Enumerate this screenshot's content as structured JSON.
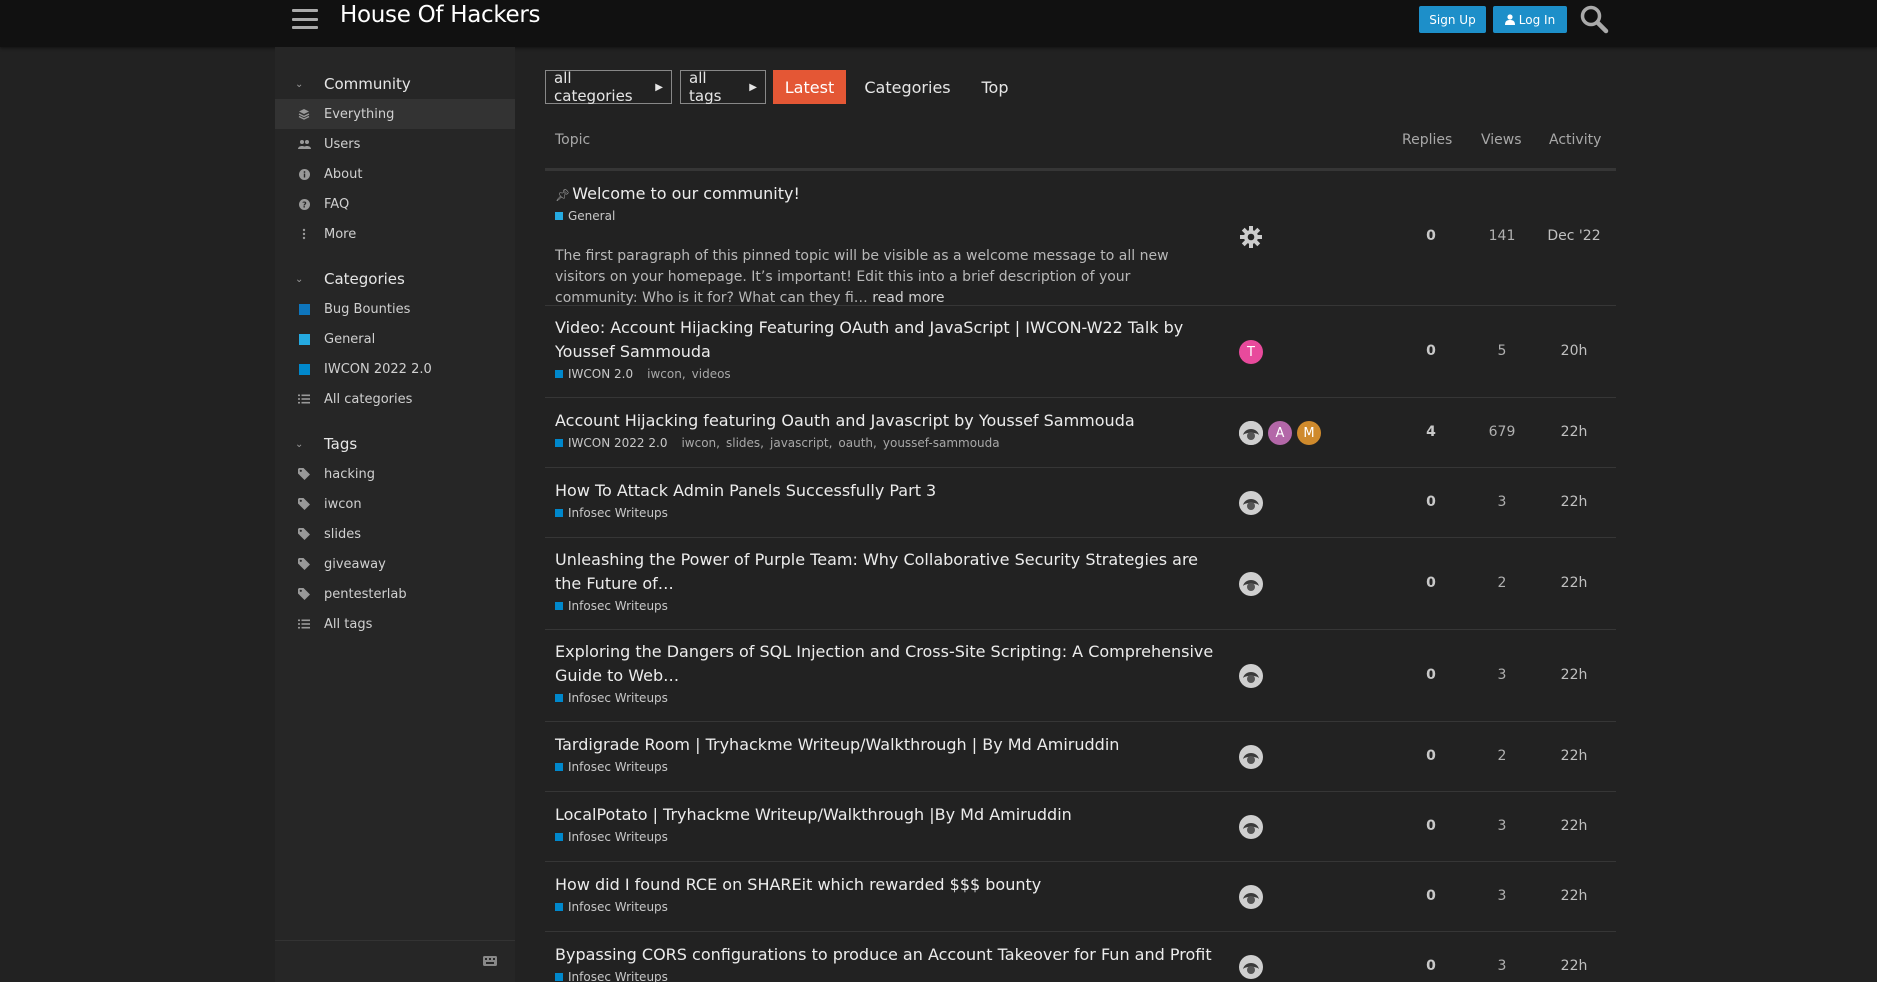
{
  "header": {
    "title": "House Of Hackers",
    "signup_label": "Sign Up",
    "login_label": "Log In"
  },
  "sidebar": {
    "community": {
      "label": "Community",
      "items": [
        {
          "label": "Everything",
          "icon": "layers-icon"
        },
        {
          "label": "Users",
          "icon": "users-icon"
        },
        {
          "label": "About",
          "icon": "info-icon"
        },
        {
          "label": "FAQ",
          "icon": "question-icon"
        },
        {
          "label": "More",
          "icon": "vertical-ellipsis-icon"
        }
      ]
    },
    "categories": {
      "label": "Categories",
      "items": [
        {
          "label": "Bug Bounties",
          "color": "#0e76bd"
        },
        {
          "label": "General",
          "color": "#25aae1"
        },
        {
          "label": "IWCON 2022 2.0",
          "color": "#0088cc"
        },
        {
          "label": "All categories",
          "icon": "list-icon"
        }
      ]
    },
    "tags": {
      "label": "Tags",
      "items": [
        {
          "label": "hacking"
        },
        {
          "label": "iwcon"
        },
        {
          "label": "slides"
        },
        {
          "label": "giveaway"
        },
        {
          "label": "pentesterlab"
        },
        {
          "label": "All tags",
          "icon": "list-icon"
        }
      ]
    }
  },
  "nav": {
    "categories_dropdown": "all categories",
    "tags_dropdown": "all tags",
    "tabs": [
      "Latest",
      "Categories",
      "Top"
    ],
    "accent": "#e45735"
  },
  "table": {
    "headers": {
      "topic": "Topic",
      "replies": "Replies",
      "views": "Views",
      "activity": "Activity"
    },
    "rows": [
      {
        "title": "Welcome to our community!",
        "pinned": true,
        "category": "General",
        "tags": [],
        "excerpt": "The first paragraph of this pinned topic will be visible as a welcome message to all new visitors on your homepage. It’s important! Edit this into a brief description of your community: Who is it for? What can they fi…",
        "read_more": "read more",
        "replies": "0",
        "views": "141",
        "activity": "Dec '22"
      },
      {
        "title": "Video: Account Hijacking Featuring OAuth and JavaScript | IWCON-W22 Talk by Youssef Sammouda",
        "category": "IWCON 2.0",
        "tags": [
          "iwcon",
          "videos"
        ],
        "avatars": [
          {
            "letter": "T",
            "color": "#e84a9c"
          }
        ],
        "replies": "0",
        "views": "5",
        "activity": "20h"
      },
      {
        "title": "Account Hijacking featuring Oauth and Javascript by Youssef Sammouda",
        "category": "IWCON 2022 2.0",
        "tags": [
          "iwcon",
          "slides",
          "javascript",
          "oauth",
          "youssef-sammouda"
        ],
        "avatars": [
          {
            "letter": ""
          },
          {
            "letter": "A",
            "color": "#b367a8"
          },
          {
            "letter": "M",
            "color": "#cf8a2c"
          }
        ],
        "replies": "4",
        "views": "679",
        "activity": "22h"
      },
      {
        "title": "How To Attack Admin Panels Successfully Part 3",
        "category": "Infosec Writeups",
        "tags": [],
        "replies": "0",
        "views": "3",
        "activity": "22h"
      },
      {
        "title": "Unleashing the Power of Purple Team: Why Collaborative Security Strategies are the Future of…",
        "category": "Infosec Writeups",
        "tags": [],
        "replies": "0",
        "views": "2",
        "activity": "22h"
      },
      {
        "title": "Exploring the Dangers of SQL Injection and Cross-Site Scripting: A Comprehensive Guide to Web…",
        "category": "Infosec Writeups",
        "tags": [],
        "replies": "0",
        "views": "3",
        "activity": "22h"
      },
      {
        "title": "Tardigrade Room | Tryhackme Writeup/Walkthrough | By Md Amiruddin",
        "category": "Infosec Writeups",
        "tags": [],
        "replies": "0",
        "views": "2",
        "activity": "22h"
      },
      {
        "title": "LocalPotato | Tryhackme Writeup/Walkthrough |By Md Amiruddin",
        "category": "Infosec Writeups",
        "tags": [],
        "replies": "0",
        "views": "3",
        "activity": "22h"
      },
      {
        "title": "How did I found RCE on SHAREit which rewarded $$$ bounty",
        "category": "Infosec Writeups",
        "tags": [],
        "replies": "0",
        "views": "3",
        "activity": "22h"
      },
      {
        "title": "Bypassing CORS configurations to produce an Account Takeover for Fun and Profit",
        "category": "Infosec Writeups",
        "tags": [],
        "replies": "0",
        "views": "3",
        "activity": "22h"
      }
    ]
  }
}
